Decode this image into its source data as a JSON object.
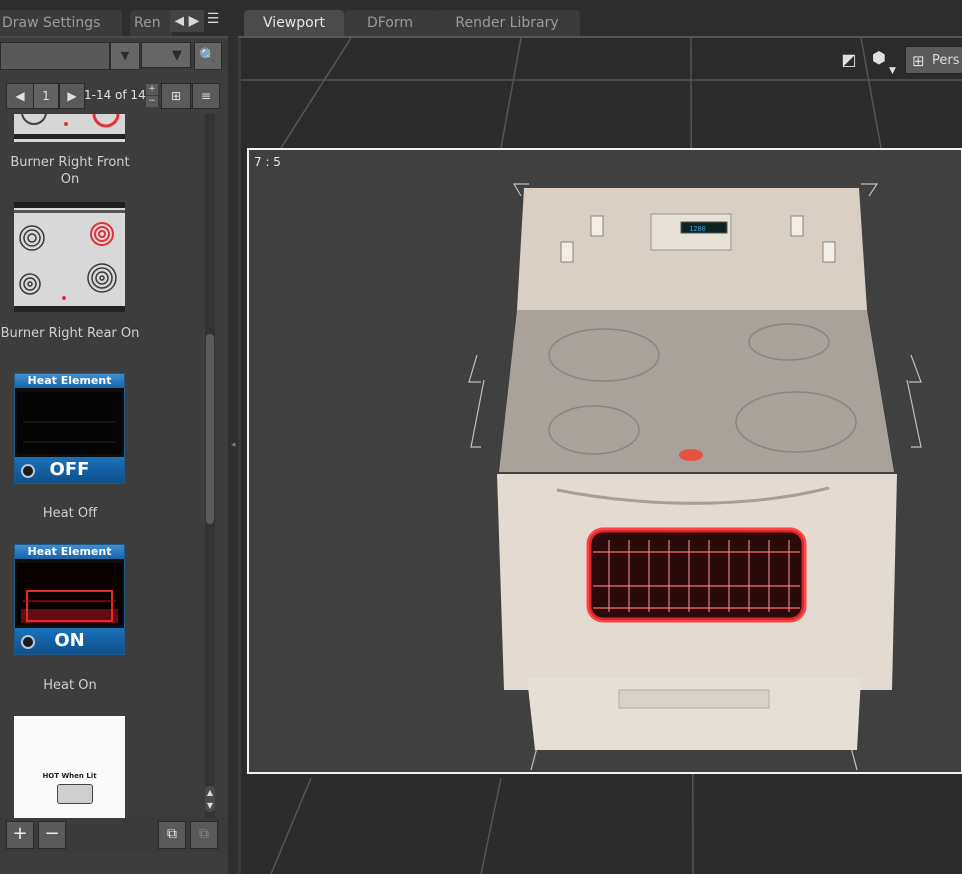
{
  "left_tabs": [
    {
      "label": "Draw Settings",
      "active": false
    },
    {
      "label": "Ren",
      "active": false
    }
  ],
  "right_tabs": [
    {
      "label": "Viewport",
      "active": true
    },
    {
      "label": "DForm",
      "active": false
    },
    {
      "label": "Render Library",
      "active": false
    }
  ],
  "pager": {
    "page": "1",
    "range": "1-14 of 14"
  },
  "items": [
    {
      "label": "Burner Right Front On"
    },
    {
      "label": "Burner Right Rear On"
    },
    {
      "label": "Heat Off",
      "tile_title": "Heat Element",
      "tile_state": "OFF"
    },
    {
      "label": "Heat On",
      "tile_title": "Heat Element",
      "tile_state": "ON"
    },
    {
      "label": "",
      "tile_text": "HOT When Lit"
    }
  ],
  "viewport": {
    "frame_ratio": "7 : 5",
    "camera_label": "Pers"
  },
  "colors": {
    "tile_blue": "#1b72bb",
    "burner_red": "#e0323c",
    "oven_glow": "#ff2a2a",
    "frame_border": "#f2f2f2"
  },
  "icons": [
    "left-arrow-icon",
    "right-arrow-icon",
    "pane-menu-icon",
    "dropdown-icon",
    "search-icon",
    "prev-page-icon",
    "next-page-icon",
    "grid-view-icon",
    "list-view-icon",
    "add-icon",
    "remove-icon",
    "copy-icon",
    "settings-icon",
    "camera-icon",
    "perspective-icon"
  ]
}
